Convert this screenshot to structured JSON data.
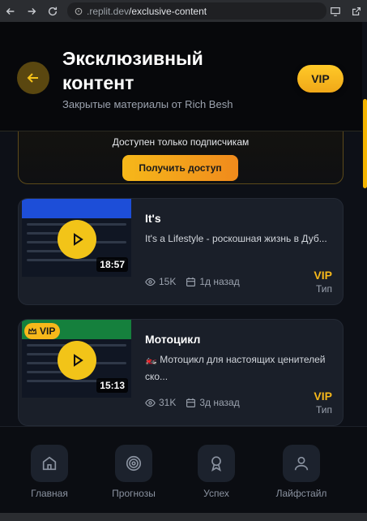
{
  "browser": {
    "url_host": ".replit.dev",
    "url_path": "/exclusive-content"
  },
  "header": {
    "title": "Эксклюзивный контент",
    "subtitle": "Закрытые материалы от Rich Besh",
    "vip_label": "VIP"
  },
  "promo": {
    "text": "Доступен только подписчикам",
    "button_label": "Получить доступ"
  },
  "posts": [
    {
      "title": "It's",
      "description": "It's a Lifestyle - роскошная жизнь в Дуб...",
      "duration": "18:57",
      "views": "15K",
      "date": "1д назад",
      "tier": "VIP",
      "tier_label": "Тип",
      "thumb_color": "#1d4ed8"
    },
    {
      "title": "Мотоцикл",
      "description": "🏍️ Мотоцикл для настоящих ценителей ско...",
      "duration": "15:13",
      "views": "31K",
      "date": "3д назад",
      "tier": "VIP",
      "tier_label": "Тип",
      "badge": "VIP",
      "thumb_color": "#15803d"
    }
  ],
  "nav": [
    {
      "label": "Главная",
      "icon": "home-icon"
    },
    {
      "label": "Прогнозы",
      "icon": "target-icon"
    },
    {
      "label": "Успех",
      "icon": "award-icon"
    },
    {
      "label": "Лайфстайл",
      "icon": "user-icon"
    }
  ],
  "colors": {
    "accent": "#f6b81a",
    "background": "#0d1017",
    "card": "#1a1f29"
  }
}
